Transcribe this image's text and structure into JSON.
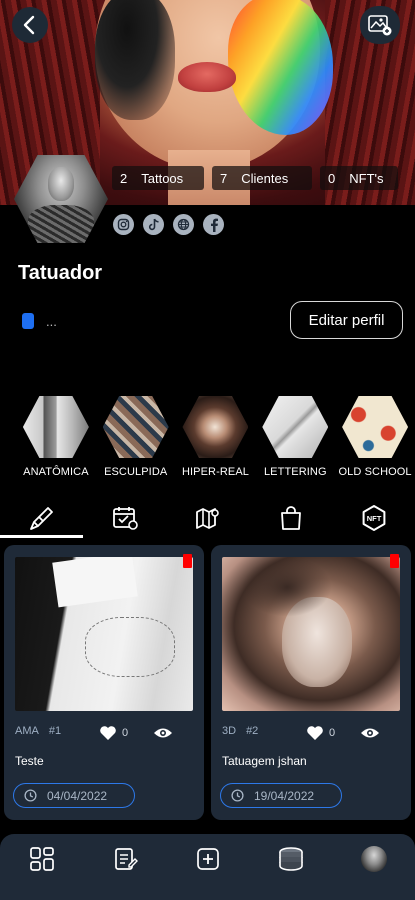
{
  "header": {
    "back_icon": "chevron-left-icon",
    "cover_edit_icon": "image-edit-icon"
  },
  "profile": {
    "stats": [
      {
        "count": "2",
        "label": "Tattoos"
      },
      {
        "count": "7",
        "label": "Clientes"
      },
      {
        "count": "0",
        "label": "NFT's"
      }
    ],
    "social_icons": [
      "instagram-icon",
      "tiktok-icon",
      "globe-icon",
      "facebook-icon"
    ],
    "role": "Tatuador",
    "bio": "...",
    "edit_button": "Editar perfil"
  },
  "categories": [
    {
      "label": "ANATÔMICA"
    },
    {
      "label": "ESCULPIDA"
    },
    {
      "label": "HIPER-REAL"
    },
    {
      "label": "LETTERING"
    },
    {
      "label": "OLD SCHOOL"
    }
  ],
  "tabs": [
    {
      "icon": "tattoo-machine-icon",
      "active": true
    },
    {
      "icon": "calendar-check-icon",
      "active": false
    },
    {
      "icon": "map-icon",
      "active": false
    },
    {
      "icon": "shopping-bag-icon",
      "active": false
    },
    {
      "icon": "nft-icon",
      "active": false
    }
  ],
  "cards": [
    {
      "style": "AMA",
      "number": "#1",
      "likes": "0",
      "title": "Teste",
      "date": "04/04/2022"
    },
    {
      "style": "3D",
      "number": "#2",
      "likes": "0",
      "title": "Tatuagem jshan",
      "date": "19/04/2022"
    }
  ],
  "nft_badge": "NFT",
  "bottom_nav": [
    "dashboard-icon",
    "clipboard-icon",
    "add-icon",
    "coins-icon",
    "avatar-icon"
  ],
  "colors": {
    "background": "#000000",
    "card": "#1f2a38",
    "accent_blue": "#2d78e8",
    "badge_red": "#ff0000"
  }
}
